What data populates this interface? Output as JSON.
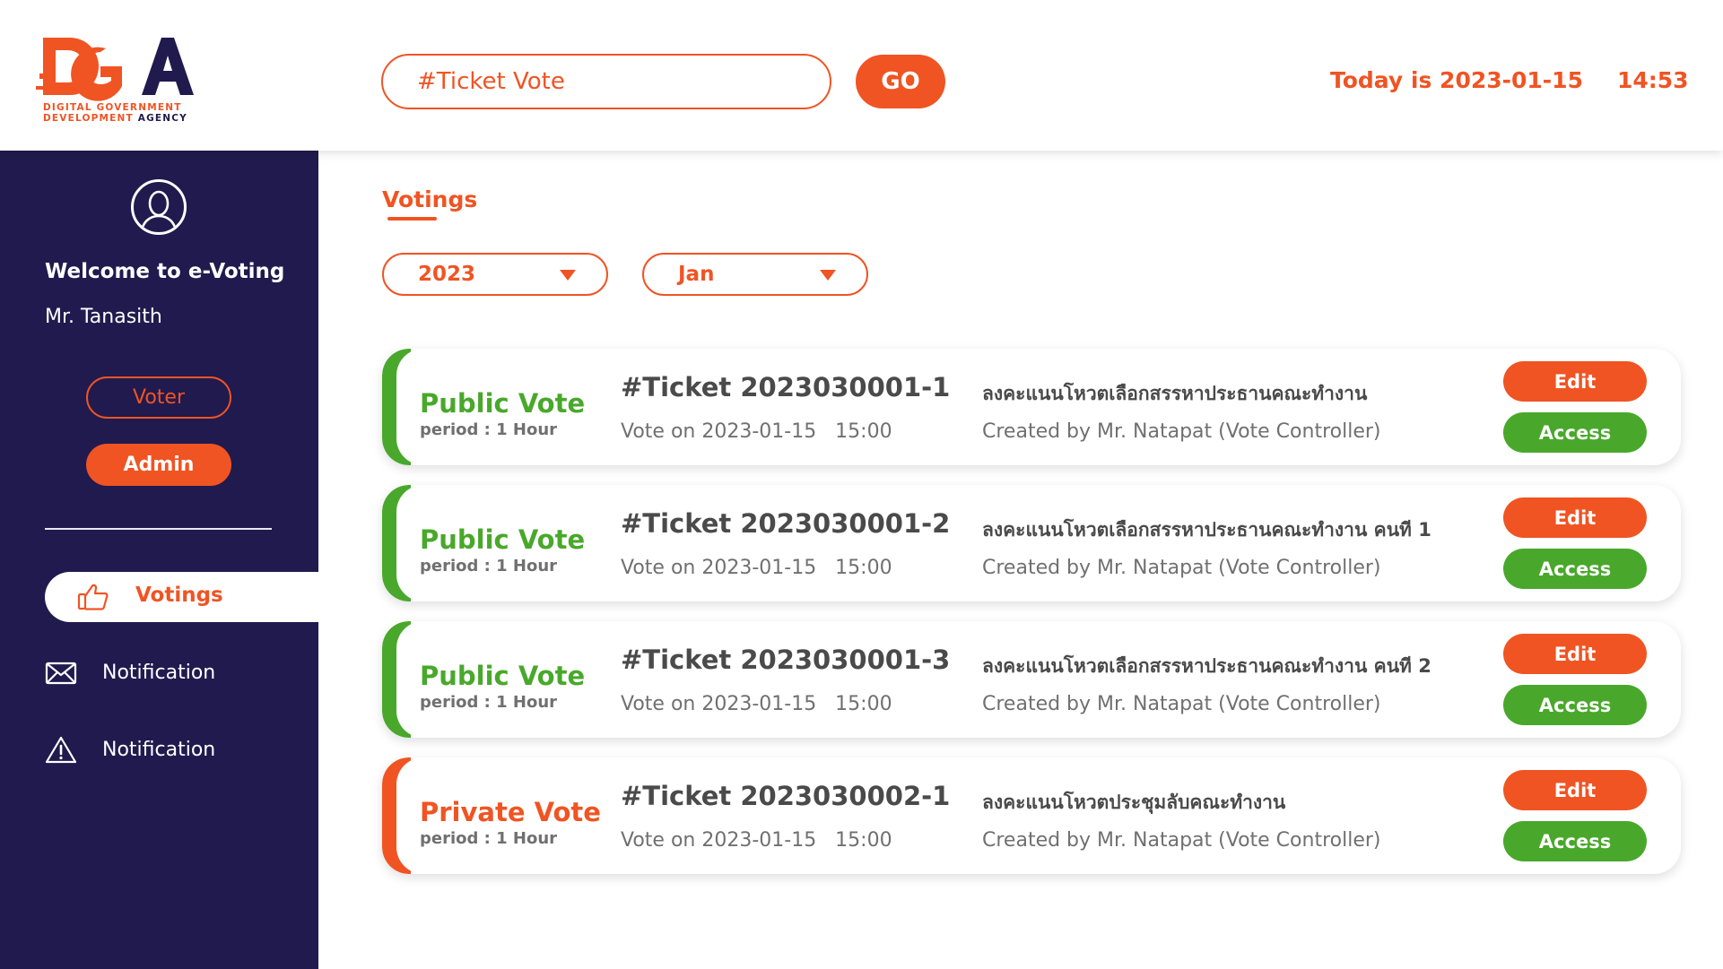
{
  "colors": {
    "accent": "#F05423",
    "sidebar": "#211A4E",
    "public": "#49A82B",
    "private": "#F05423"
  },
  "logo": {
    "mark": "DGA",
    "line1": "DIGITAL GOVERNMENT",
    "line2a": "DEVELOPMENT ",
    "line2b": "AGENCY"
  },
  "header": {
    "search_value": "#Ticket Vote",
    "go_label": "GO",
    "today": "Today is 2023-01-15",
    "time": "14:53"
  },
  "sidebar": {
    "welcome": "Welcome to e-Voting",
    "user": "Mr. Tanasith",
    "roles": {
      "voter": "Voter",
      "admin": "Admin"
    },
    "nav": [
      {
        "label": "Votings",
        "icon": "thumbs-up-icon",
        "active": true
      },
      {
        "label": "Notification",
        "icon": "envelope-icon"
      },
      {
        "label": "Notification",
        "icon": "warning-icon"
      }
    ]
  },
  "main": {
    "title": "Votings",
    "filters": {
      "year": "2023",
      "month": "Jan"
    },
    "cards": [
      {
        "type": "Public Vote",
        "period": "period : 1 Hour",
        "ticket": "#Ticket 2023030001-1",
        "vote_on": "Vote on 2023-01-15   15:00",
        "topic": "ลงคะแนนโหวตเลือกสรรหาประธานคณะทำงาน",
        "creator": "Created by Mr. Natapat (Vote Controller)",
        "edit": "Edit",
        "access": "Access"
      },
      {
        "type": "Public Vote",
        "period": "period : 1 Hour",
        "ticket": "#Ticket 2023030001-2",
        "vote_on": "Vote on 2023-01-15   15:00",
        "topic": "ลงคะแนนโหวตเลือกสรรหาประธานคณะทำงาน คนที 1",
        "creator": "Created by Mr. Natapat (Vote Controller)",
        "edit": "Edit",
        "access": "Access"
      },
      {
        "type": "Public Vote",
        "period": "period : 1 Hour",
        "ticket": "#Ticket 2023030001-3",
        "vote_on": "Vote on 2023-01-15   15:00",
        "topic": "ลงคะแนนโหวตเลือกสรรหาประธานคณะทำงาน คนที 2",
        "creator": "Created by Mr. Natapat (Vote Controller)",
        "edit": "Edit",
        "access": "Access"
      },
      {
        "type": "Private Vote",
        "period": "period : 1 Hour",
        "ticket": "#Ticket 2023030002-1",
        "vote_on": "Vote on 2023-01-15   15:00",
        "topic": "ลงคะแนนโหวตประชุมลับคณะทำงาน",
        "creator": "Created by Mr. Natapat (Vote Controller)",
        "edit": "Edit",
        "access": "Access"
      }
    ]
  }
}
